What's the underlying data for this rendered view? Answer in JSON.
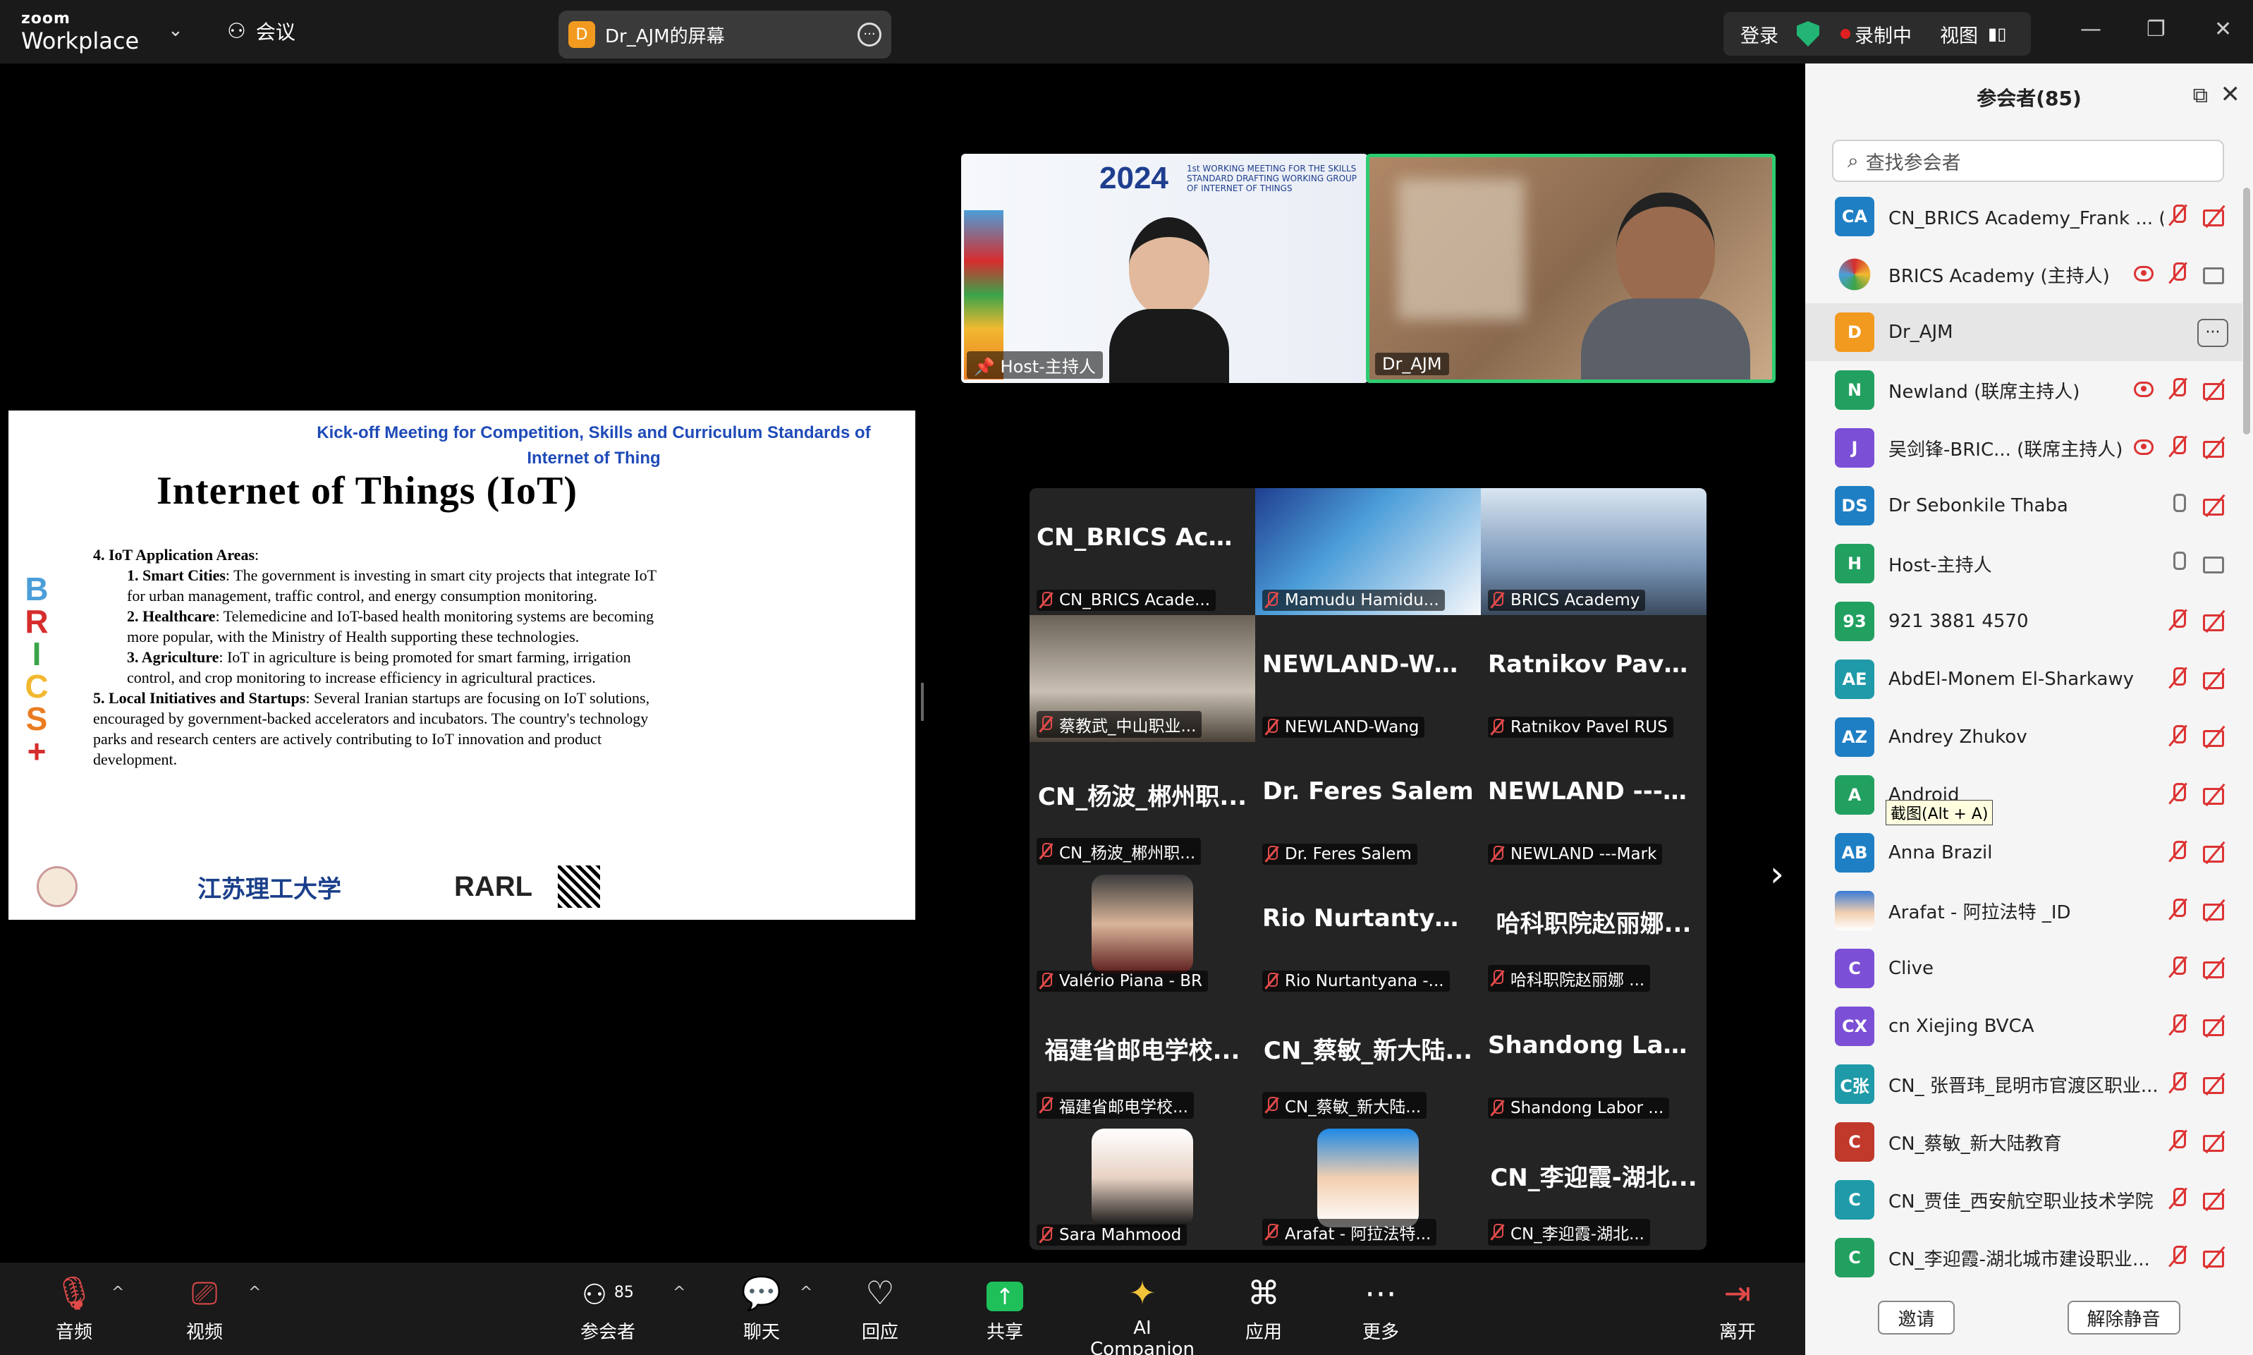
{
  "topbar": {
    "logo_line1": "zoom",
    "logo_line2": "Workplace",
    "meeting_label": "会议",
    "share_initial": "D",
    "share_title": "Dr_AJM的屏幕",
    "signin": "登录",
    "recording": "录制中",
    "view": "视图"
  },
  "slide": {
    "subtitle": "Kick-off Meeting for Competition, Skills and Curriculum Standards of Internet of Thing",
    "title": "Internet of Things (IoT)",
    "brics_letters": [
      "B",
      "R",
      "I",
      "C",
      "S",
      "+"
    ],
    "sec4_head": "4. IoT Application Areas",
    "items": [
      {
        "lead": "1.  Smart Cities",
        "text": ": The government is investing in smart city projects that integrate IoT for urban management, traffic control, and energy consumption monitoring."
      },
      {
        "lead": "2.  Healthcare",
        "text": ": Telemedicine and IoT-based health monitoring systems are becoming more popular, with the Ministry of Health supporting these technologies."
      },
      {
        "lead": "3.  Agriculture",
        "text": ": IoT in agriculture is being promoted for smart farming, irrigation control, and crop monitoring to increase efficiency in agricultural practices."
      }
    ],
    "sec5_head": "5. Local Initiatives and Startups",
    "sec5_text": ": Several Iranian startups are focusing on IoT solutions, encouraged by government-backed accelerators and incubators. The country's technology parks and research centers are actively contributing to IoT innovation and product development.",
    "logo_uni": "江苏理工大学",
    "logo_rarl": "RARL"
  },
  "speakers": [
    {
      "name": "Host-主持人",
      "banner_year": "2024",
      "banner_text": "1st WORKING MEETING FOR THE SKILLS STANDARD DRAFTING WORKING GROUP OF INTERNET OF THINGS"
    },
    {
      "name": "Dr_AJM"
    }
  ],
  "gallery": [
    {
      "big": "CN_BRICS Acad...",
      "label": "CN_BRICS Acade..."
    },
    {
      "big": "",
      "label": "Mamudu Hamidu..."
    },
    {
      "big": "",
      "label": "BRICS Academy"
    },
    {
      "big": "",
      "label": "蔡教武_中山职业..."
    },
    {
      "big": "NEWLAND-Wang",
      "label": "NEWLAND-Wang"
    },
    {
      "big": "Ratnikov Pavel...",
      "label": "Ratnikov Pavel RUS"
    },
    {
      "big": "CN_杨波_郴州职...",
      "label": "CN_杨波_郴州职..."
    },
    {
      "big": "Dr. Feres Salem",
      "label": "Dr. Feres Salem"
    },
    {
      "big": "NEWLAND ---M...",
      "label": "NEWLAND ---Mark"
    },
    {
      "big": "",
      "label": "Valério Piana - BR"
    },
    {
      "big": "Rio Nurtantyan...",
      "label": "Rio Nurtantyana -..."
    },
    {
      "big": "哈科职院赵丽娜...",
      "label": "哈科职院赵丽娜 ..."
    },
    {
      "big": "福建省邮电学校...",
      "label": "福建省邮电学校..."
    },
    {
      "big": "CN_蔡敏_新大陆...",
      "label": "CN_蔡敏_新大陆..."
    },
    {
      "big": "Shandong Labor...",
      "label": "Shandong Labor ..."
    },
    {
      "big": "",
      "label": "Sara Mahmood"
    },
    {
      "big": "",
      "label": "Arafat - 阿拉法特..."
    },
    {
      "big": "CN_李迎霞-湖北...",
      "label": "CN_李迎霞-湖北..."
    }
  ],
  "toolbar": {
    "audio": "音频",
    "video": "视频",
    "participants": "参会者",
    "participants_count": "85",
    "chat": "聊天",
    "react": "回应",
    "share": "共享",
    "ai": "AI Companion",
    "apps": "应用",
    "more": "更多",
    "leave": "离开"
  },
  "panel": {
    "title": "参会者(85)",
    "search_placeholder": "查找参会者",
    "tooltip": "截图(Alt + A)",
    "invite": "邀请",
    "unmute": "解除静音",
    "participants": [
      {
        "initials": "CA",
        "color": "#1f7fc4",
        "name": "CN_BRICS Academy_Frank ...  (我)",
        "mic": "off",
        "cam": "off"
      },
      {
        "initials": "",
        "color": "#ffffff",
        "name": "BRICS Academy (主持人)",
        "mic": "off",
        "cam": "on",
        "rec": true,
        "logo": true
      },
      {
        "initials": "D",
        "color": "#f29a1f",
        "name": "Dr_AJM",
        "more": true
      },
      {
        "initials": "N",
        "color": "#22a060",
        "name": "Newland (联席主持人)",
        "mic": "off",
        "cam": "off",
        "rec": true
      },
      {
        "initials": "J",
        "color": "#7b4fd6",
        "name": "吴剑锋-BRIC...  (联席主持人)",
        "mic": "off",
        "cam": "off",
        "rec": true
      },
      {
        "initials": "DS",
        "color": "#1f7fc4",
        "name": "Dr Sebonkile Thaba",
        "mic": "on",
        "cam": "off"
      },
      {
        "initials": "H",
        "color": "#22a060",
        "name": "Host-主持人",
        "mic": "on",
        "cam": "on"
      },
      {
        "initials": "93",
        "color": "#22a060",
        "name": "921 3881 4570",
        "mic": "off",
        "cam": "off"
      },
      {
        "initials": "AE",
        "color": "#1f9aa8",
        "name": "AbdEl-Monem El-Sharkawy",
        "mic": "off",
        "cam": "off"
      },
      {
        "initials": "AZ",
        "color": "#1f7fc4",
        "name": "Andrey Zhukov",
        "mic": "off",
        "cam": "off"
      },
      {
        "initials": "A",
        "color": "#22a060",
        "name": "Android",
        "mic": "off",
        "cam": "off",
        "tooltip": true
      },
      {
        "initials": "AB",
        "color": "#1f7fc4",
        "name": "Anna Brazil",
        "mic": "off",
        "cam": "off"
      },
      {
        "initials": "",
        "color": "#3a7bd5",
        "name": "Arafat - 阿拉法特 _ID",
        "mic": "off",
        "cam": "off",
        "photo": true
      },
      {
        "initials": "C",
        "color": "#7b4fd6",
        "name": "Clive",
        "mic": "off",
        "cam": "off"
      },
      {
        "initials": "CX",
        "color": "#7b4fd6",
        "name": "cn Xiejing BVCA",
        "mic": "off",
        "cam": "off"
      },
      {
        "initials": "C张",
        "color": "#1f9aa8",
        "name": "CN_ 张晋玮_昆明市官渡区职业...",
        "mic": "off",
        "cam": "off"
      },
      {
        "initials": "C",
        "color": "#c0392b",
        "name": "CN_蔡敏_新大陆教育",
        "mic": "off",
        "cam": "off"
      },
      {
        "initials": "C",
        "color": "#1f9aa8",
        "name": "CN_贾佳_西安航空职业技术学院",
        "mic": "off",
        "cam": "off"
      },
      {
        "initials": "C",
        "color": "#22a060",
        "name": "CN_李迎霞-湖北城市建设职业...",
        "mic": "off",
        "cam": "off"
      }
    ]
  }
}
